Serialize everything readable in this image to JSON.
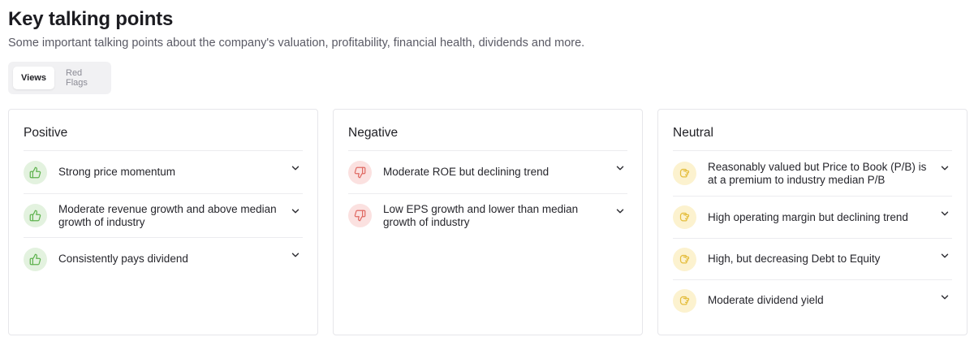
{
  "header": {
    "title": "Key talking points",
    "subtitle": "Some important talking points about the company's valuation, profitability, financial health, dividends and more."
  },
  "tabs": [
    {
      "label": "Views",
      "active": true
    },
    {
      "label": "Red Flags",
      "active": false
    }
  ],
  "colors": {
    "positive_bg": "#e3f2df",
    "positive_icon": "#5fb34f",
    "negative_bg": "#fbe1e0",
    "negative_icon": "#e06a63",
    "neutral_bg": "#fcf2cf",
    "neutral_icon": "#e4bd3c"
  },
  "cards": [
    {
      "title": "Positive",
      "icon": "thumbs-up-icon",
      "items": [
        {
          "text": "Strong price momentum"
        },
        {
          "text": "Moderate revenue growth and above median growth of industry"
        },
        {
          "text": "Consistently pays dividend"
        }
      ]
    },
    {
      "title": "Negative",
      "icon": "thumbs-down-icon",
      "items": [
        {
          "text": "Moderate ROE but declining trend"
        },
        {
          "text": "Low EPS growth and lower than median growth of industry"
        }
      ]
    },
    {
      "title": "Neutral",
      "icon": "thumbs-sideways-icon",
      "items": [
        {
          "text": "Reasonably valued but Price to Book (P/B) is at a premium to industry median P/B"
        },
        {
          "text": "High operating margin but declining trend"
        },
        {
          "text": "High, but decreasing Debt to Equity"
        },
        {
          "text": "Moderate dividend yield"
        }
      ]
    }
  ]
}
